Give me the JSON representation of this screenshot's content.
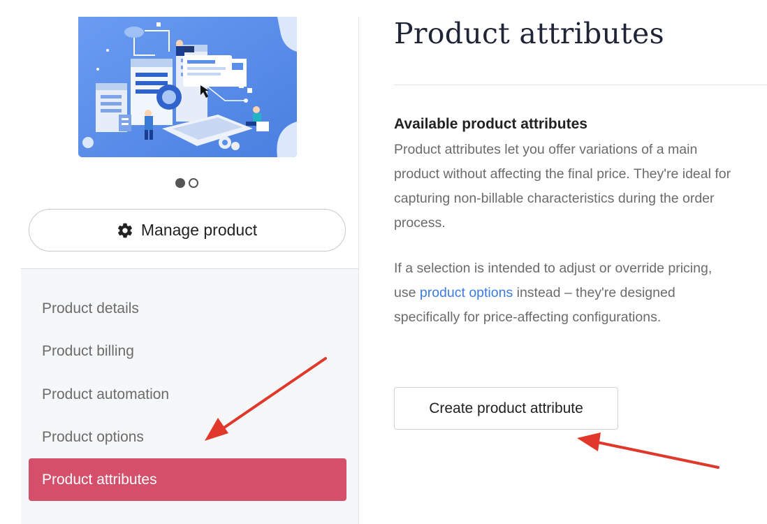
{
  "sidebar": {
    "manage_button_label": "Manage product",
    "carousel": {
      "total": 2,
      "active_index": 0
    },
    "nav_items": [
      {
        "label": "Product details",
        "active": false
      },
      {
        "label": "Product billing",
        "active": false
      },
      {
        "label": "Product automation",
        "active": false
      },
      {
        "label": "Product options",
        "active": false
      },
      {
        "label": "Product attributes",
        "active": true
      }
    ]
  },
  "main": {
    "title": "Product attributes",
    "section_heading": "Available product attributes",
    "paragraph1": "Product attributes let you offer variations of a main product without affecting the final price. They're ideal for capturing non-billable characteristics during the order process.",
    "paragraph2_before": "If a selection is intended to adjust or override pricing, use ",
    "paragraph2_link": "product options",
    "paragraph2_after": " instead – they're designed specifically for price-affecting configurations.",
    "create_button_label": "Create product attribute"
  },
  "icons": {
    "manage_button_icon": "gear-icon"
  },
  "colors": {
    "active_nav_bg": "#d4506a",
    "link": "#3b7be0",
    "annotation_arrow": "#e0382b",
    "image_bg": "#5b8fec"
  }
}
